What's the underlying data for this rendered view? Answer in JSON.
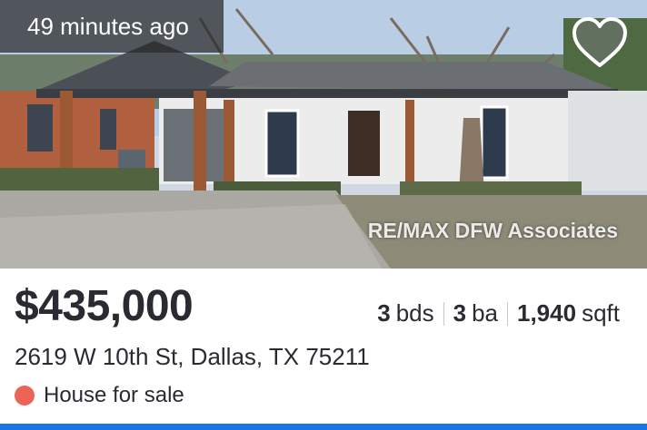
{
  "listing": {
    "time_ago": "49 minutes ago",
    "watermark": "RE/MAX DFW Associates",
    "price": "$435,000",
    "beds_num": "3",
    "beds_unit": "bds",
    "baths_num": "3",
    "baths_unit": "ba",
    "sqft_num": "1,940",
    "sqft_unit": "sqft",
    "address": "2619 W 10th St, Dallas, TX 75211",
    "status": "House for sale",
    "favorite_icon": "heart-icon",
    "photo_alt": "house photo"
  },
  "colors": {
    "status_dot": "#ec6455",
    "accent_bar": "#1a73e8",
    "text": "#2a2a33"
  }
}
